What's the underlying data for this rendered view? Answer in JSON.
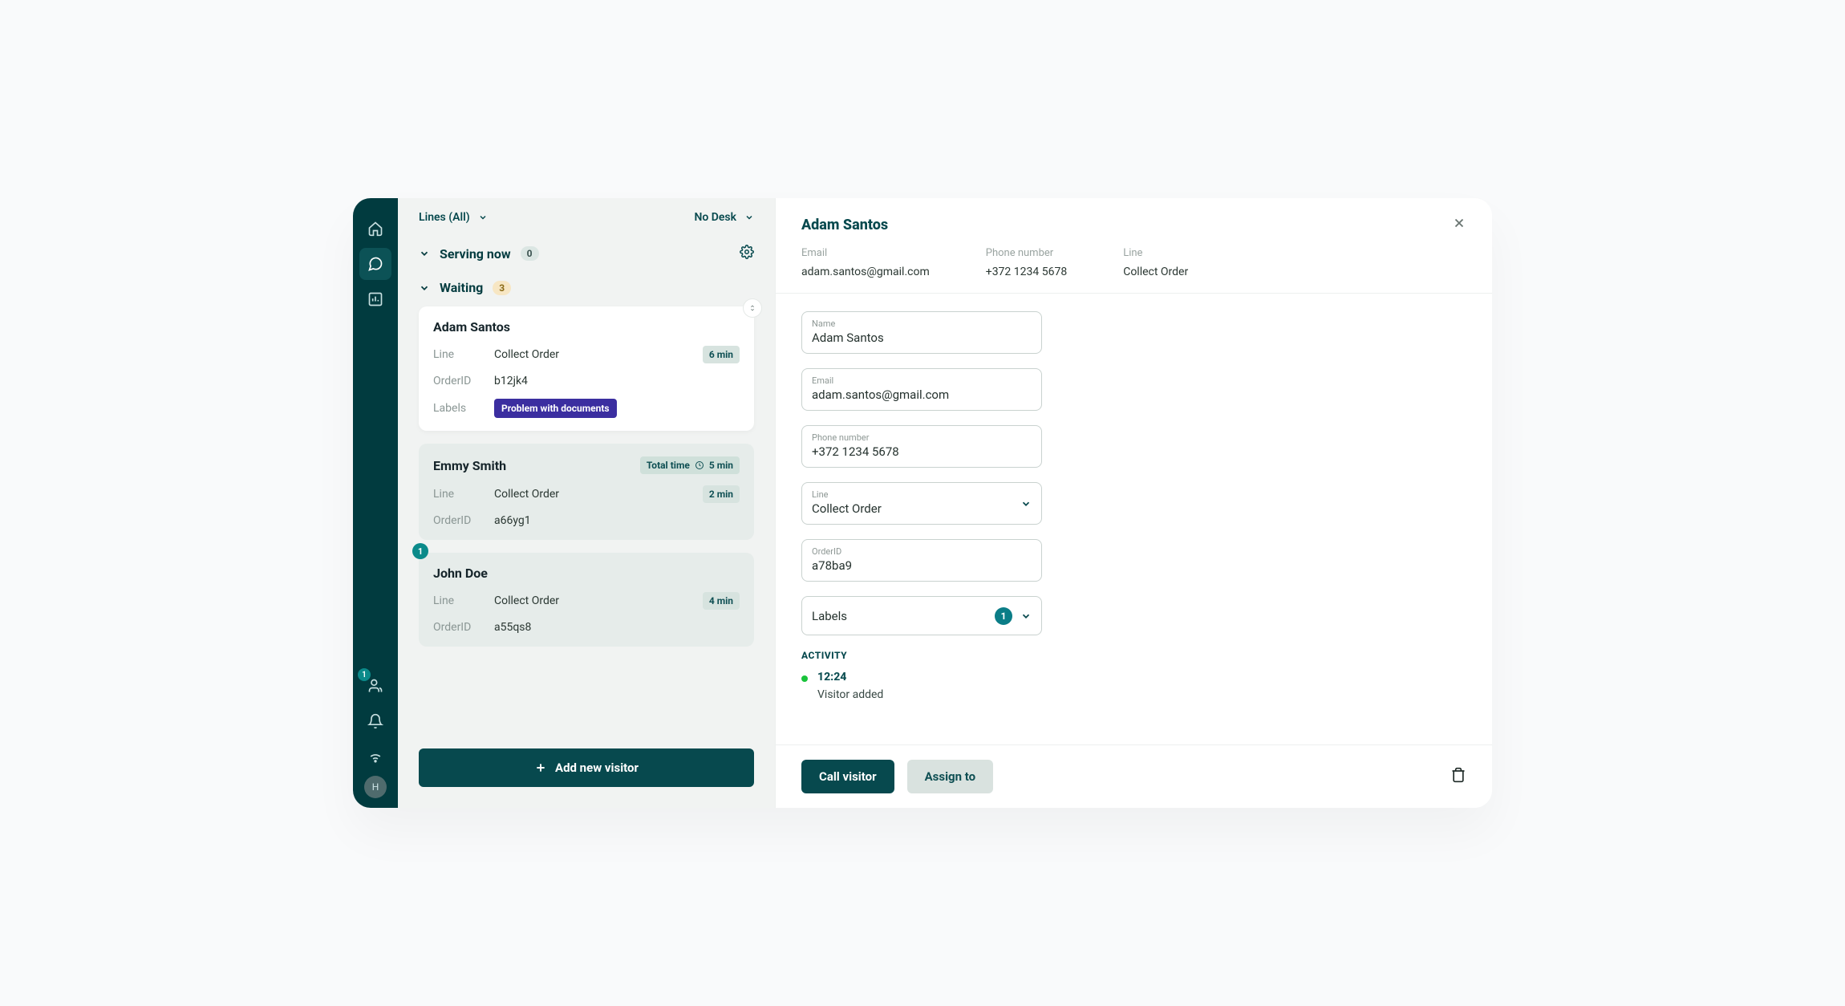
{
  "rail": {
    "users_badge": "1",
    "avatar_initial": "H"
  },
  "queue": {
    "lines_dd": "Lines (All)",
    "desk_dd": "No Desk",
    "serving": {
      "label": "Serving now",
      "count": "0"
    },
    "waiting": {
      "label": "Waiting",
      "count": "3"
    },
    "add_button": "Add new visitor",
    "cards": [
      {
        "name": "Adam Santos",
        "line_k": "Line",
        "line_v": "Collect Order",
        "order_k": "OrderID",
        "order_v": "b12jk4",
        "labels_k": "Labels",
        "labels_v": "Problem with documents",
        "time": "6 min"
      },
      {
        "name": "Emmy Smith",
        "line_k": "Line",
        "line_v": "Collect Order",
        "order_k": "OrderID",
        "order_v": "a66yg1",
        "total_label": "Total time",
        "total_value": "5 min",
        "time": "2 min"
      },
      {
        "idx": "1",
        "name": "John Doe",
        "line_k": "Line",
        "line_v": "Collect Order",
        "order_k": "OrderID",
        "order_v": "a55qs8",
        "time": "4 min"
      }
    ]
  },
  "detail": {
    "title": "Adam Santos",
    "meta": {
      "email_k": "Email",
      "email_v": "adam.santos@gmail.com",
      "phone_k": "Phone number",
      "phone_v": "+372 1234 5678",
      "line_k": "Line",
      "line_v": "Collect Order"
    },
    "fields": {
      "name_l": "Name",
      "name_v": "Adam Santos",
      "email_l": "Email",
      "email_v": "adam.santos@gmail.com",
      "phone_l": "Phone number",
      "phone_v": "+372 1234 5678",
      "line_l": "Line",
      "line_v": "Collect Order",
      "order_l": "OrderID",
      "order_v": "a78ba9",
      "labels_l": "Labels",
      "labels_count": "1"
    },
    "activity_h": "ACTIVITY",
    "activity": {
      "time": "12:24",
      "label": "Visitor added"
    },
    "footer": {
      "call": "Call visitor",
      "assign": "Assign to"
    }
  }
}
